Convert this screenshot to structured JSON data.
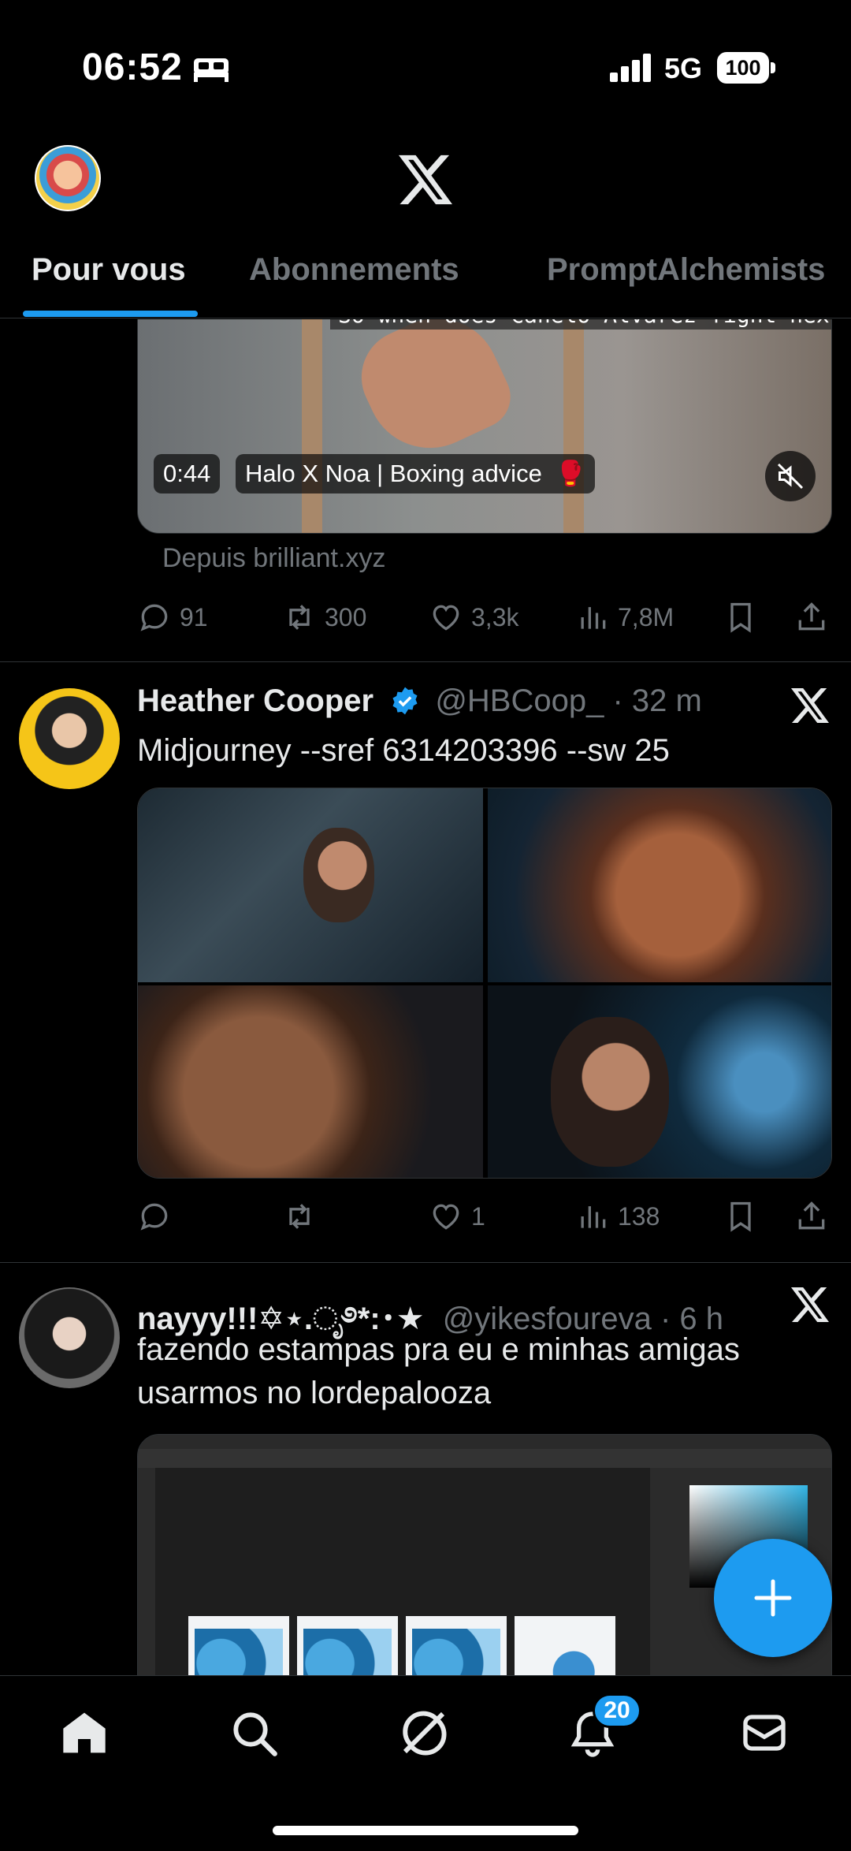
{
  "status_bar": {
    "time": "06:52",
    "network": "5G",
    "battery": "100"
  },
  "header": {
    "logo": "X"
  },
  "tabs": [
    {
      "label": "Pour vous",
      "active": true
    },
    {
      "label": "Abonnements",
      "active": false
    },
    {
      "label": "PromptAlchemists",
      "active": false
    }
  ],
  "post1": {
    "video_caption": "So when does Canelo Alvarez fight next?",
    "duration": "0:44",
    "video_title": "Halo X Noa | Boxing advice",
    "video_emoji": "🥊",
    "source": "Depuis brilliant.xyz",
    "replies": "91",
    "reposts": "300",
    "likes": "3,3k",
    "views": "7,8M"
  },
  "post2": {
    "name": "Heather Cooper",
    "handle": "@HBCoop_",
    "time": "· 32 m",
    "text": "Midjourney --sref 6314203396 --sw 25",
    "replies": "",
    "reposts": "",
    "likes": "1",
    "views": "138"
  },
  "post3": {
    "name": "nayyy!!!✡︎⋆.ೃ࿔*:･★",
    "handle": "@yikesfoureva",
    "time": "· 6 h",
    "text": "fazendo estampas pra eu e minhas amigas usarmos no lordepalooza"
  },
  "bottom_nav": {
    "items": [
      "home-icon",
      "search-icon",
      "grok-icon",
      "notifications-icon",
      "messages-icon"
    ],
    "notification_count": "20"
  },
  "colors": {
    "accent": "#1d9bf0",
    "background": "#000000",
    "muted": "#71767b",
    "text": "#e7e9ea"
  }
}
